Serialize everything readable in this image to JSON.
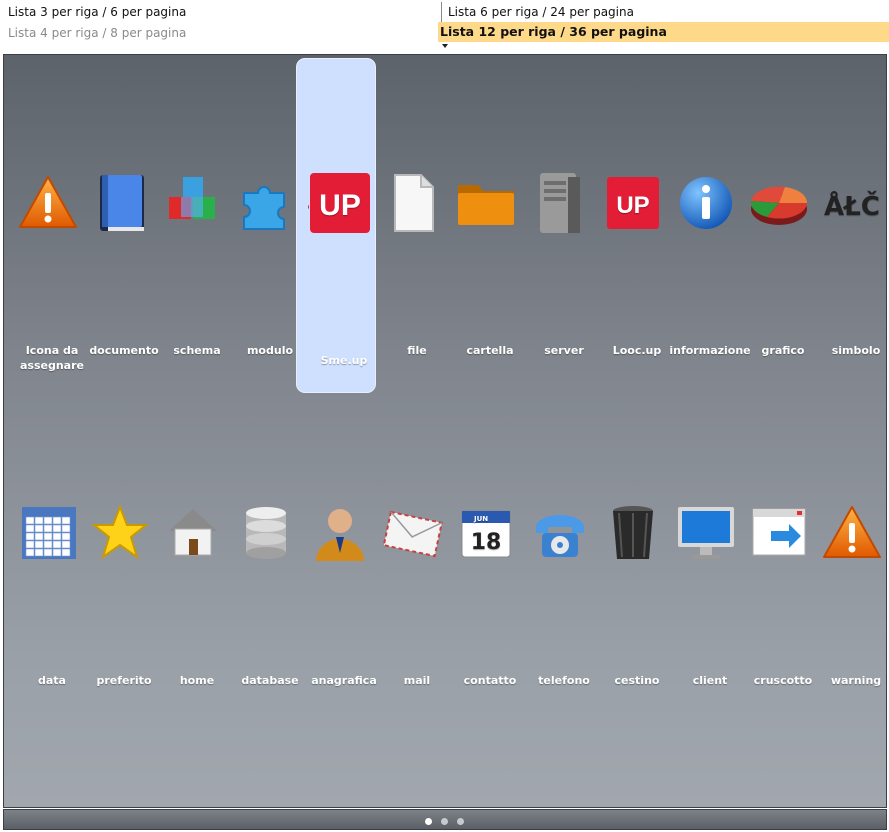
{
  "view_options": [
    {
      "label": "Lista 3 per riga / 6 per pagina",
      "state": "normal"
    },
    {
      "label": "Lista 4 per riga / 8 per pagina",
      "state": "dimmed"
    },
    {
      "label": "Lista 6 per riga / 24 per pagina",
      "state": "normal"
    },
    {
      "label": "Lista 12 per riga / 36 per pagina",
      "state": "selected"
    }
  ],
  "colors": {
    "selected_option": "#ffd98a",
    "panel_top": "#5d636b",
    "panel_bottom": "#a2a7ae",
    "selected_tile": "#cfe0ff"
  },
  "grid": {
    "rows": [
      [
        {
          "label": "Icona da assegnare",
          "icon": "warning-icon"
        },
        {
          "label": "documento",
          "icon": "book-icon"
        },
        {
          "label": "schema",
          "icon": "cubes-icon"
        },
        {
          "label": "modulo",
          "icon": "puzzle-icon"
        },
        {
          "label": "Sme.up",
          "icon": "smeup-logo-icon",
          "selected": true
        },
        {
          "label": "file",
          "icon": "file-icon"
        },
        {
          "label": "cartella",
          "icon": "folder-icon"
        },
        {
          "label": "server",
          "icon": "server-icon"
        },
        {
          "label": "Looc.up",
          "icon": "loocup-logo-icon"
        },
        {
          "label": "informazione",
          "icon": "info-icon"
        },
        {
          "label": "grafico",
          "icon": "pie-chart-icon"
        },
        {
          "label": "simbolo",
          "icon": "symbol-icon"
        }
      ],
      [
        {
          "label": "data",
          "icon": "calendar-grid-icon"
        },
        {
          "label": "preferito",
          "icon": "star-icon"
        },
        {
          "label": "home",
          "icon": "house-icon"
        },
        {
          "label": "database",
          "icon": "database-icon"
        },
        {
          "label": "anagrafica",
          "icon": "person-icon"
        },
        {
          "label": "mail",
          "icon": "envelope-icon"
        },
        {
          "label": "contatto",
          "icon": "calendar-icon"
        },
        {
          "label": "telefono",
          "icon": "telephone-icon"
        },
        {
          "label": "cestino",
          "icon": "trash-icon"
        },
        {
          "label": "client",
          "icon": "monitor-icon"
        },
        {
          "label": "cruscotto",
          "icon": "dashboard-window-icon"
        },
        {
          "label": "warning",
          "icon": "warning-icon"
        }
      ]
    ],
    "icon_texts": {
      "smeup": "UP",
      "loocup": "UP",
      "symbol": "ÅŁČ",
      "calendar_month": "JUN",
      "calendar_day": "18"
    }
  },
  "pager": {
    "pages": 3,
    "current": 1
  }
}
